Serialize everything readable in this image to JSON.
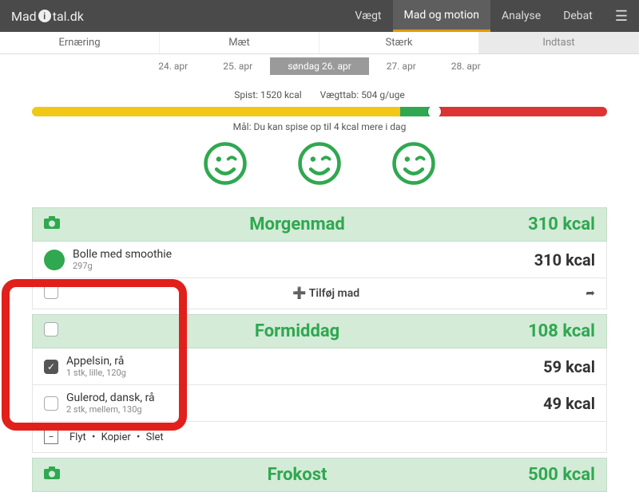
{
  "logo": {
    "pre": "Mad",
    "post": "tal.dk",
    "i": "i"
  },
  "nav": {
    "items": [
      "Vægt",
      "Mad og motion",
      "Analyse",
      "Debat"
    ],
    "activeIndex": 1
  },
  "subnav": {
    "items": [
      "Ernæring",
      "Mæt",
      "Stærk",
      "Indtast"
    ],
    "activeIndex": 3
  },
  "dates": {
    "items": [
      "24. apr",
      "25. apr",
      "søndag 26. apr",
      "27. apr",
      "28. apr"
    ],
    "activeIndex": 2
  },
  "stats": {
    "eaten": "Spist: 1520 kcal",
    "loss": "Vægttab: 504 g/uge"
  },
  "goal": "Mål: Du kan spise op til 4 kcal mere i dag",
  "meals": [
    {
      "title": "Morgenmad",
      "kcal": "310 kcal",
      "foods": [
        {
          "name": "Bolle med smoothie",
          "sub": "297g",
          "kcal": "310 kcal",
          "checked": false,
          "dot": true
        }
      ],
      "add": {
        "label": "Tilføj mad"
      }
    },
    {
      "title": "Formiddag",
      "kcal": "108 kcal",
      "foods": [
        {
          "name": "Appelsin, rå",
          "sub": "1 stk, lille, 120g",
          "kcal": "59 kcal",
          "checked": true
        },
        {
          "name": "Gulerod, dansk, rå",
          "sub": "2 stk, mellem, 130g",
          "kcal": "49 kcal",
          "checked": false
        }
      ],
      "actions": {
        "labels": [
          "Flyt",
          "Kopier",
          "Slet"
        ]
      }
    },
    {
      "title": "Frokost",
      "kcal": "500 kcal",
      "foods": []
    }
  ]
}
